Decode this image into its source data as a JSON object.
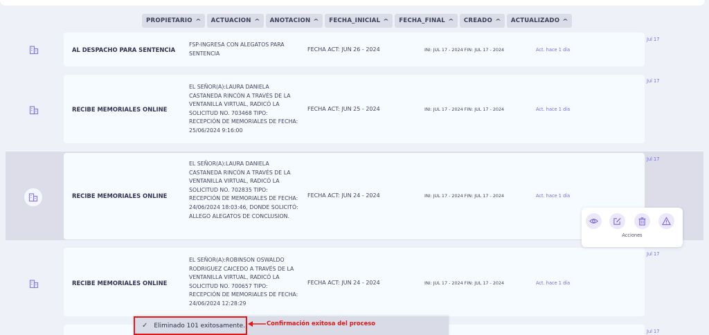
{
  "columns": [
    "PROPIETARIO",
    "ACTUACION",
    "ANOTACION",
    "FECHA_INICIAL",
    "FECHA_FINAL",
    "CREADO",
    "ACTUALIZADO"
  ],
  "rows": [
    {
      "actuacion": "AL DESPACHO PARA SENTENCIA",
      "anotacion": "FSP-INGRESA CON ALEGATOS PARA SENTENCIA",
      "fecha_act": "FECHA ACT: JUN 26 - 2024",
      "ini_fin": "INI: JUL 17 - 2024  FIN: JUL 17 - 2024",
      "actualizado": "Act. hace 1 día",
      "creado": "Jul 17"
    },
    {
      "actuacion": "RECIBE MEMORIALES ONLINE",
      "anotacion": "EL SEÑOR(A):LAURA DANIELA CASTANEDA RINCÓN A TRAVÉS DE LA VENTANILLA VIRTUAL, RADICÓ LA SOLICITUD NO. 703468 TIPO: RECEPCIÓN DE MEMORIALES DE FECHA: 25/06/2024 9:16:00",
      "fecha_act": "FECHA ACT: JUN 25 - 2024",
      "ini_fin": "INI: JUL 17 - 2024  FIN: JUL 17 - 2024",
      "actualizado": "Act. hace 1 día",
      "creado": "Jul 17"
    },
    {
      "actuacion": "RECIBE MEMORIALES ONLINE",
      "anotacion": "EL SEÑOR(A):LAURA DANIELA CASTANEDA RINCÓN A TRAVÉS DE LA VENTANILLA VIRTUAL, RADICÓ LA SOLICITUD NO. 702835 TIPO: RECEPCIÓN DE MEMORIALES DE FECHA: 24/06/2024 18:03:46, DONDE SOLICITÓ: ALLEGO ALEGATOS DE CONCLUSION.",
      "fecha_act": "FECHA ACT: JUN 24 - 2024",
      "ini_fin": "INI: JUL 17 - 2024  FIN: JUL 17 - 2024",
      "actualizado": "Act. hace 1 día",
      "creado": "Jul 17"
    },
    {
      "actuacion": "RECIBE MEMORIALES ONLINE",
      "anotacion": "EL SEÑOR(A):ROBINSON OSWALDO RODRIGUEZ CAICEDO A TRAVÉS DE LA VENTANILLA VIRTUAL, RADICÓ LA SOLICITUD NO. 700657 TIPO: RECEPCIÓN DE MEMORIALES DE FECHA: 24/06/2024 12:28:29",
      "fecha_act": "FECHA ACT: JUN 24 - 2024",
      "ini_fin": "INI: JUL 17 - 2024  FIN: JUL 17 - 2024",
      "actualizado": "Act. hace 1 día",
      "creado": "Jul 17"
    },
    {
      "creado": "Jul 17"
    }
  ],
  "actions_panel": {
    "label": "Acciones",
    "icons": [
      "eye-icon",
      "edit-icon",
      "trash-icon",
      "warning-icon"
    ]
  },
  "toast": {
    "message": "Eliminado 101 exitosamente.",
    "annotation": "Confirmación exitosa del proceso"
  },
  "colors": {
    "accent": "#7a6bd8",
    "highlight": "#e01a1a"
  }
}
